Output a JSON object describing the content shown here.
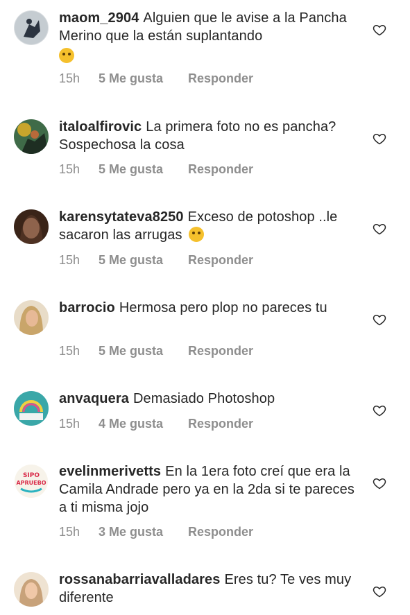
{
  "comments": [
    {
      "username": "maom_2904",
      "text": "Alguien que le avise a la Pancha Merino que la están suplantando",
      "emoji": "🤣",
      "time": "15h",
      "likes": "5 Me gusta",
      "reply": "Responder",
      "avatar_color": "#9aa3a9"
    },
    {
      "username": "italoalfirovic",
      "text": "La primera foto no es pancha? Sospechosa la cosa",
      "emoji": "",
      "time": "15h",
      "likes": "5 Me gusta",
      "reply": "Responder",
      "avatar_color": "#3f6b48"
    },
    {
      "username": "karensytateva8250",
      "text": "Exceso de potoshop ..le sacaron las arrugas",
      "emoji": "🤫",
      "time": "15h",
      "likes": "5 Me gusta",
      "reply": "Responder",
      "avatar_color": "#5b3a2a"
    },
    {
      "username": "barrocio",
      "text": "Hermosa pero plop no pareces tu",
      "emoji": "",
      "time": "15h",
      "likes": "5 Me gusta",
      "reply": "Responder",
      "avatar_color": "#c9a56a"
    },
    {
      "username": "anvaquera",
      "text": "Demasiado Photoshop",
      "emoji": "",
      "time": "15h",
      "likes": "4 Me gusta",
      "reply": "Responder",
      "avatar_color": "#3aa7a8"
    },
    {
      "username": "evelinmerivetts",
      "text": "En la 1era foto creí que era la Camila Andrade pero ya en la 2da si te pareces a ti misma jojo",
      "emoji": "",
      "time": "15h",
      "likes": "3 Me gusta",
      "reply": "Responder",
      "avatar_color": "#2bb3c0",
      "avatar_text_1": "SIPO",
      "avatar_text_2": "APRUEBO"
    },
    {
      "username": "rossanabarriavalladares",
      "text": "Eres tu? Te ves muy diferente",
      "emoji": "",
      "time": "",
      "likes": "",
      "reply": "",
      "avatar_color": "#c8a27a"
    }
  ],
  "icons": {
    "like": "heart-outline-icon"
  },
  "colors": {
    "text": "#262626",
    "meta": "#8e8e8e"
  }
}
